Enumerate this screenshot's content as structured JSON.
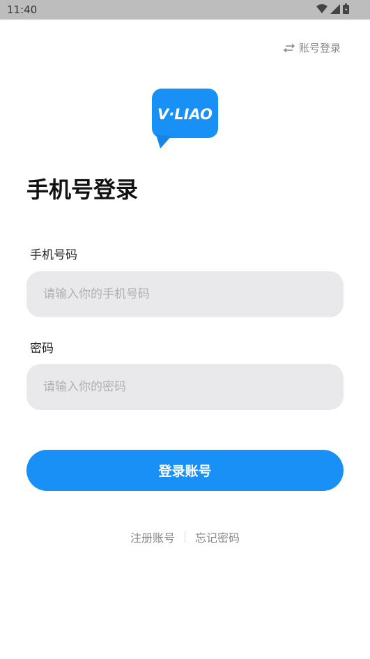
{
  "status_bar": {
    "time": "11:40",
    "icons": [
      "wifi-icon",
      "signal-icon",
      "battery-icon"
    ]
  },
  "header": {
    "switch_label": "账号登录",
    "switch_icon": "swap-arrows-icon"
  },
  "logo": {
    "text": "V·LIAO",
    "color": "#1890f5"
  },
  "page": {
    "title": "手机号登录"
  },
  "form": {
    "phone_label": "手机号码",
    "phone_placeholder": "请输入你的手机号码",
    "password_label": "密码",
    "password_placeholder": "请输入你的密码"
  },
  "actions": {
    "login_label": "登录账号",
    "register_label": "注册账号",
    "forgot_label": "忘记密码"
  },
  "colors": {
    "accent": "#1890f5",
    "input_bg": "#e9e9eb",
    "status_bar": "#bdbdbd"
  }
}
